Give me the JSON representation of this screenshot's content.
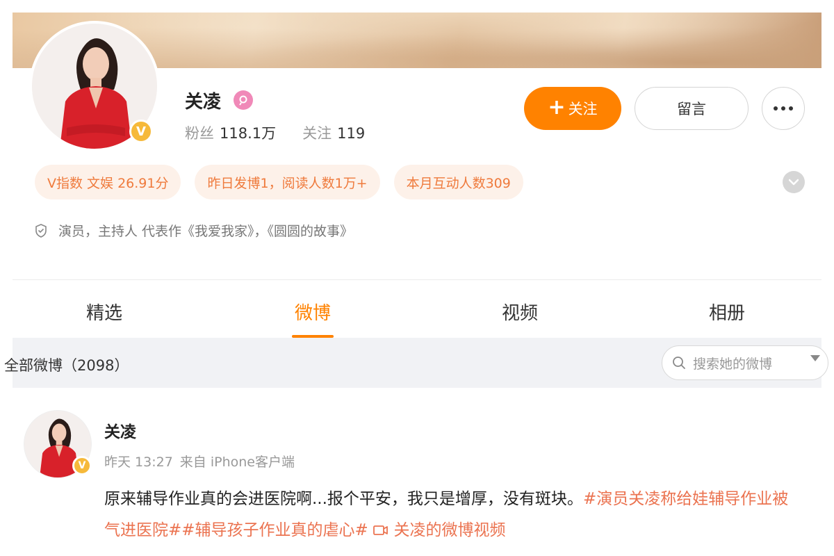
{
  "profile": {
    "name": "关凌",
    "fans_label": "粉丝",
    "fans_count": "118.1万",
    "following_label": "关注",
    "following_count": "119",
    "follow_button": "关注",
    "message_button": "留言",
    "badge_letter": "V",
    "tags": [
      "V指数 文娱 26.91分",
      "昨日发博1，阅读人数1万+",
      "本月互动人数309"
    ],
    "description": "演员，主持人 代表作《我爱我家》，《圆圆的故事》"
  },
  "tabs": [
    {
      "label": "精选",
      "active": false
    },
    {
      "label": "微博",
      "active": true
    },
    {
      "label": "视频",
      "active": false
    },
    {
      "label": "相册",
      "active": false
    }
  ],
  "filter": {
    "title": "全部微博（2098）",
    "search_placeholder": "搜索她的微博"
  },
  "post": {
    "author": "关凌",
    "time": "昨天 13:27",
    "source": "来自 iPhone客户端",
    "text": "原来辅导作业真的会进医院啊...报个平安，我只是增厚，没有斑块。",
    "hashtag1": "#演员关凌称给娃辅导作业被气进医院#",
    "hashtag2": "#辅导孩子作业真的虐心#",
    "video_link": "关凌的微博视频"
  },
  "colors": {
    "accent": "#ff8200",
    "tag_text": "#ef7a3c",
    "tag_bg": "#fdf1e9",
    "link": "#eb7350",
    "verified": "#f6b93a"
  }
}
